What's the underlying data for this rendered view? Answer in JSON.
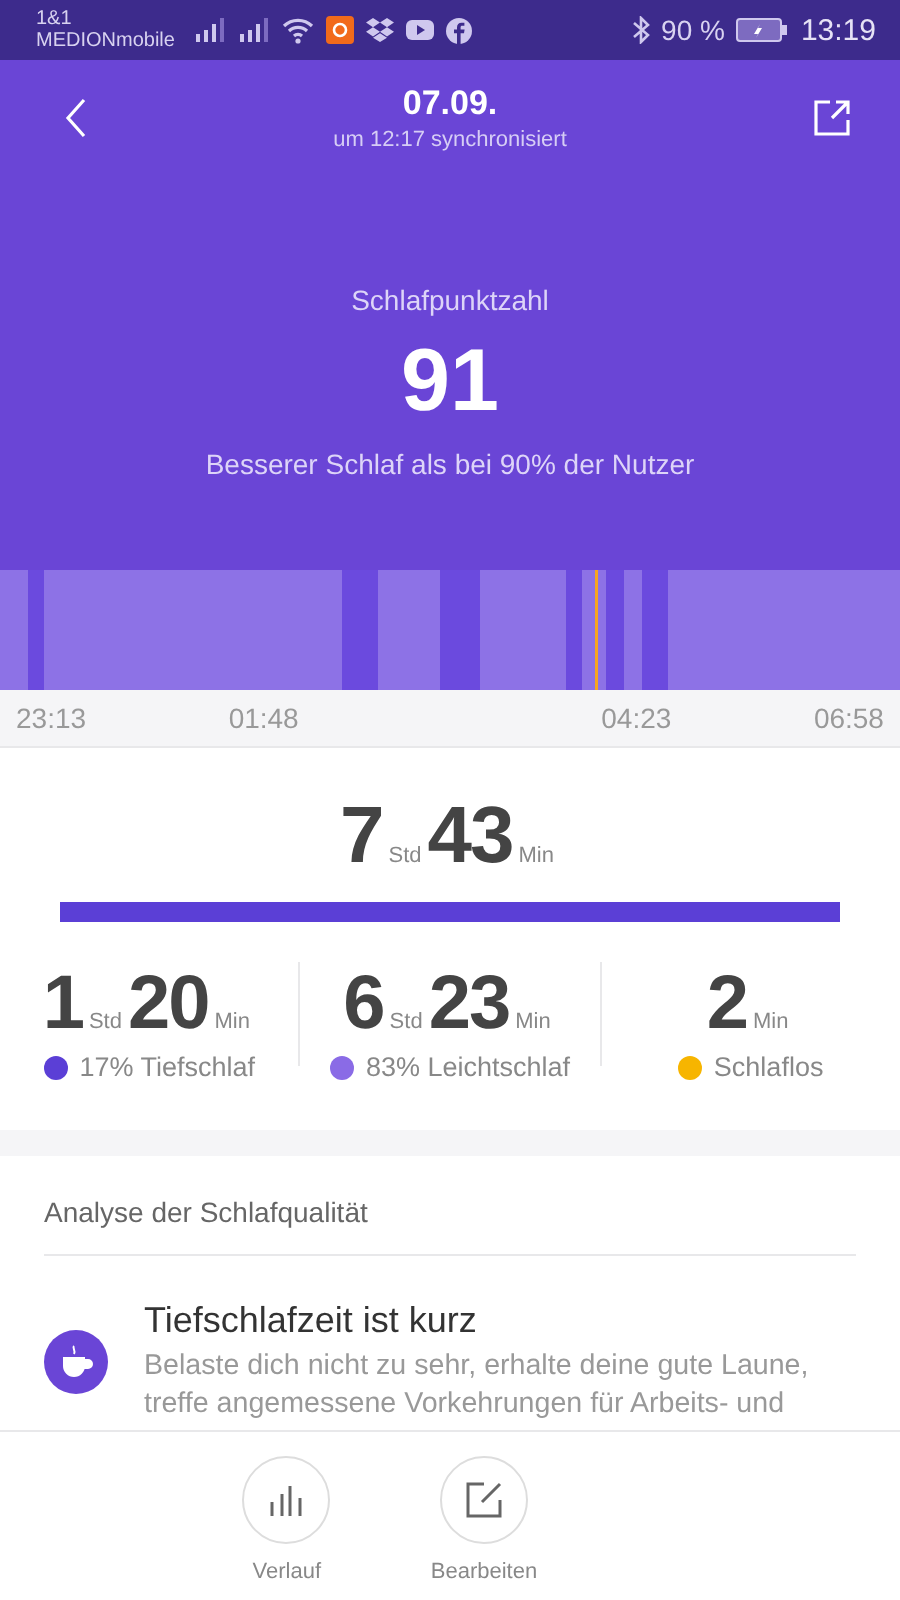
{
  "status_bar": {
    "carrier_line_1": "1&1",
    "carrier_line_2": "MEDIONmobile",
    "battery": "90 %",
    "time": "13:19"
  },
  "header": {
    "date": "07.09.",
    "sync": "um 12:17 synchronisiert"
  },
  "score": {
    "label": "Schlafpunktzahl",
    "value": "91",
    "comparison": "Besserer Schlaf als bei 90% der Nutzer"
  },
  "timeline": {
    "ticks": [
      "23:13",
      "01:48",
      "04:23",
      "06:58"
    ]
  },
  "total": {
    "hours": "7",
    "hours_unit": "Std",
    "minutes": "43",
    "minutes_unit": "Min"
  },
  "stages": [
    {
      "hours": "1",
      "hours_unit": "Std",
      "minutes": "20",
      "minutes_unit": "Min",
      "label": "17% Tiefschlaf",
      "color": "#5b3fd6"
    },
    {
      "hours": "6",
      "hours_unit": "Std",
      "minutes": "23",
      "minutes_unit": "Min",
      "label": "83% Leichtschlaf",
      "color": "#8a6be6"
    },
    {
      "minutes": "2",
      "minutes_unit": "Min",
      "label": "Schlaflos",
      "color": "#f7b500"
    }
  ],
  "analysis": {
    "title": "Analyse der Schlafqualität",
    "items": [
      {
        "heading": "Tiefschlafzeit ist kurz",
        "text": "Belaste dich nicht zu sehr, erhalte deine gute Laune, treffe angemessene Vorkehrungen für Arbeits- und"
      }
    ]
  },
  "actions": [
    {
      "label": "Verlauf",
      "kind": "history"
    },
    {
      "label": "Bearbeiten",
      "kind": "edit"
    }
  ]
}
